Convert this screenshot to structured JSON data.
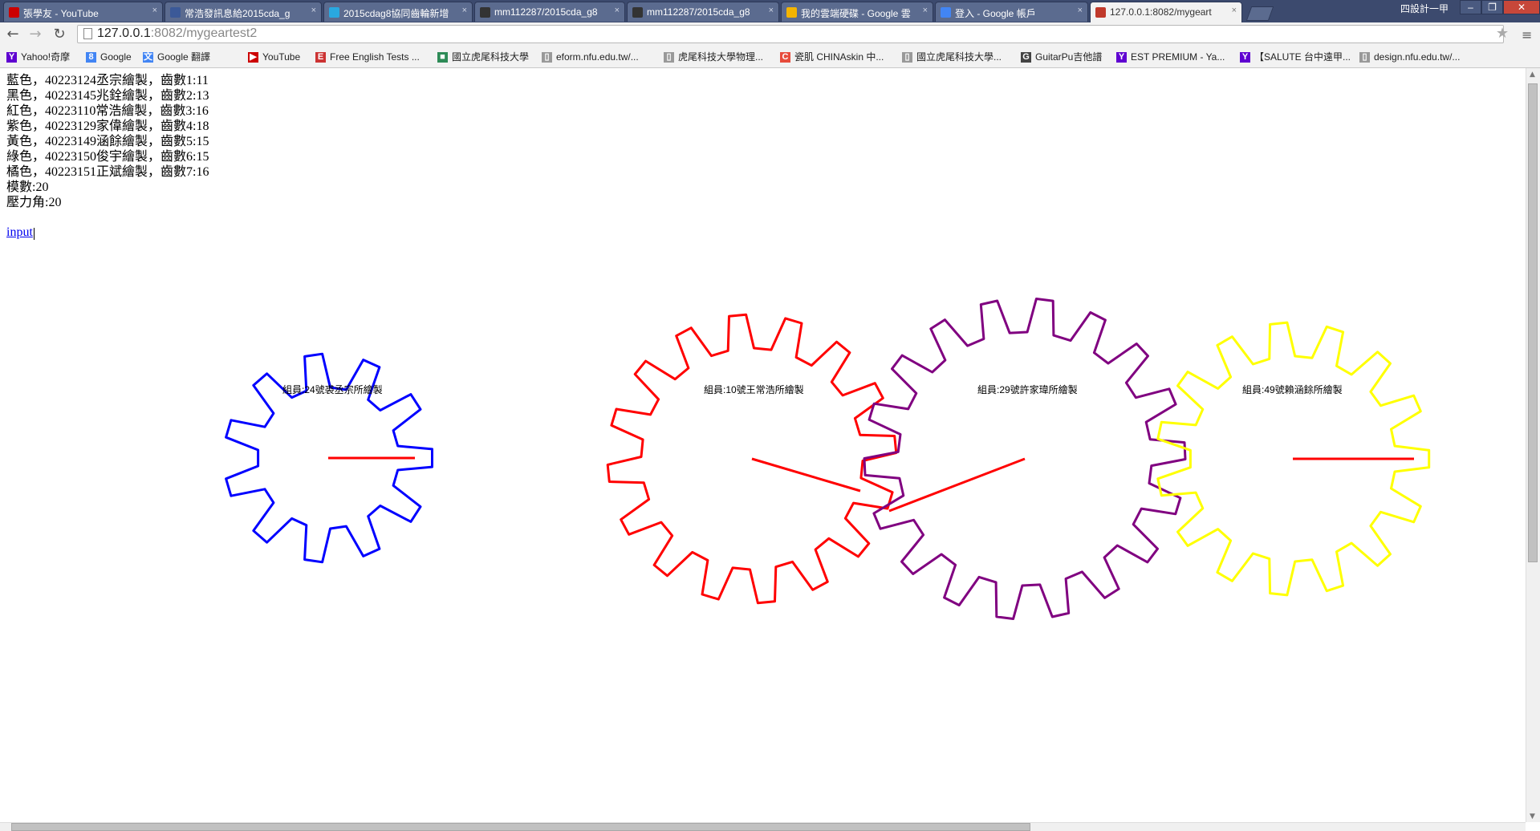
{
  "browser": {
    "tabs": [
      {
        "title": "張學友 - YouTube",
        "favicon_color": "#cc0000"
      },
      {
        "title": "常浩發訊息給2015cda_g",
        "favicon_color": "#3b5998"
      },
      {
        "title": "2015cdag8協同齒輪新增",
        "favicon_color": "#29a8e0"
      },
      {
        "title": "mm112287/2015cda_g8",
        "favicon_color": "#333333"
      },
      {
        "title": "mm112287/2015cda_g8",
        "favicon_color": "#333333"
      },
      {
        "title": "我的雲端硬碟 - Google 雲",
        "favicon_color": "#f4b400"
      },
      {
        "title": "登入 - Google 帳戶",
        "favicon_color": "#4285f4"
      },
      {
        "title": "127.0.0.1:8082/mygeart",
        "favicon_color": "#c0392b"
      }
    ],
    "window_user": "四設計一甲",
    "url_host": "127.0.0.1",
    "url_rest": ":8082/mygeartest2",
    "bookmarks": [
      {
        "label": "Yahoo!奇摩",
        "icon": "Y",
        "color": "#5f01d1"
      },
      {
        "label": "Google",
        "icon": "8",
        "color": "#4285f4"
      },
      {
        "label": "Google 翻譯",
        "icon": "文",
        "color": "#4285f4"
      },
      {
        "label": "YouTube",
        "icon": "▶",
        "color": "#cc0000"
      },
      {
        "label": "Free English Tests ...",
        "icon": "E",
        "color": "#cc3333"
      },
      {
        "label": "國立虎尾科技大學",
        "icon": "■",
        "color": "#2e8b57"
      },
      {
        "label": "eform.nfu.edu.tw/...",
        "icon": "▯",
        "color": "#999999"
      },
      {
        "label": "虎尾科技大學物理...",
        "icon": "▯",
        "color": "#999999"
      },
      {
        "label": "瓷肌 CHINAskin 中...",
        "icon": "C",
        "color": "#e74c3c"
      },
      {
        "label": "國立虎尾科技大學...",
        "icon": "▯",
        "color": "#999999"
      },
      {
        "label": "GuitarPu吉他譜",
        "icon": "G",
        "color": "#444444"
      },
      {
        "label": "EST PREMIUM - Ya...",
        "icon": "Y",
        "color": "#5f01d1"
      },
      {
        "label": "【SALUTE 台中遠甲...",
        "icon": "Y",
        "color": "#5f01d1"
      },
      {
        "label": "design.nfu.edu.tw/...",
        "icon": "▯",
        "color": "#999999"
      }
    ]
  },
  "page": {
    "info_lines": [
      "藍色，40223124丞宗繪製，齒數1:11",
      "黑色，40223145兆銓繪製，齒數2:13",
      "紅色，40223110常浩繪製，齒數3:16",
      "紫色，40223129家偉繪製，齒數4:18",
      "黃色，40223149涵餘繪製，齒數5:15",
      "綠色，40223150俊宇繪製，齒數6:15",
      "橘色，40223151正斌繪製，齒數7:16",
      "模數:20",
      "壓力角:20"
    ],
    "input_link": "input"
  },
  "gears": [
    {
      "teeth": 11,
      "color": "blue",
      "label": "組員:24號裘丞宗所繪製"
    },
    {
      "teeth": 16,
      "color": "red",
      "label": "組員:10號王常浩所繪製"
    },
    {
      "teeth": 18,
      "color": "purple",
      "label": "組員:29號許家瑋所繪製"
    },
    {
      "teeth": 15,
      "color": "yellow",
      "label": "組員:49號賴涵餘所繪製"
    }
  ]
}
